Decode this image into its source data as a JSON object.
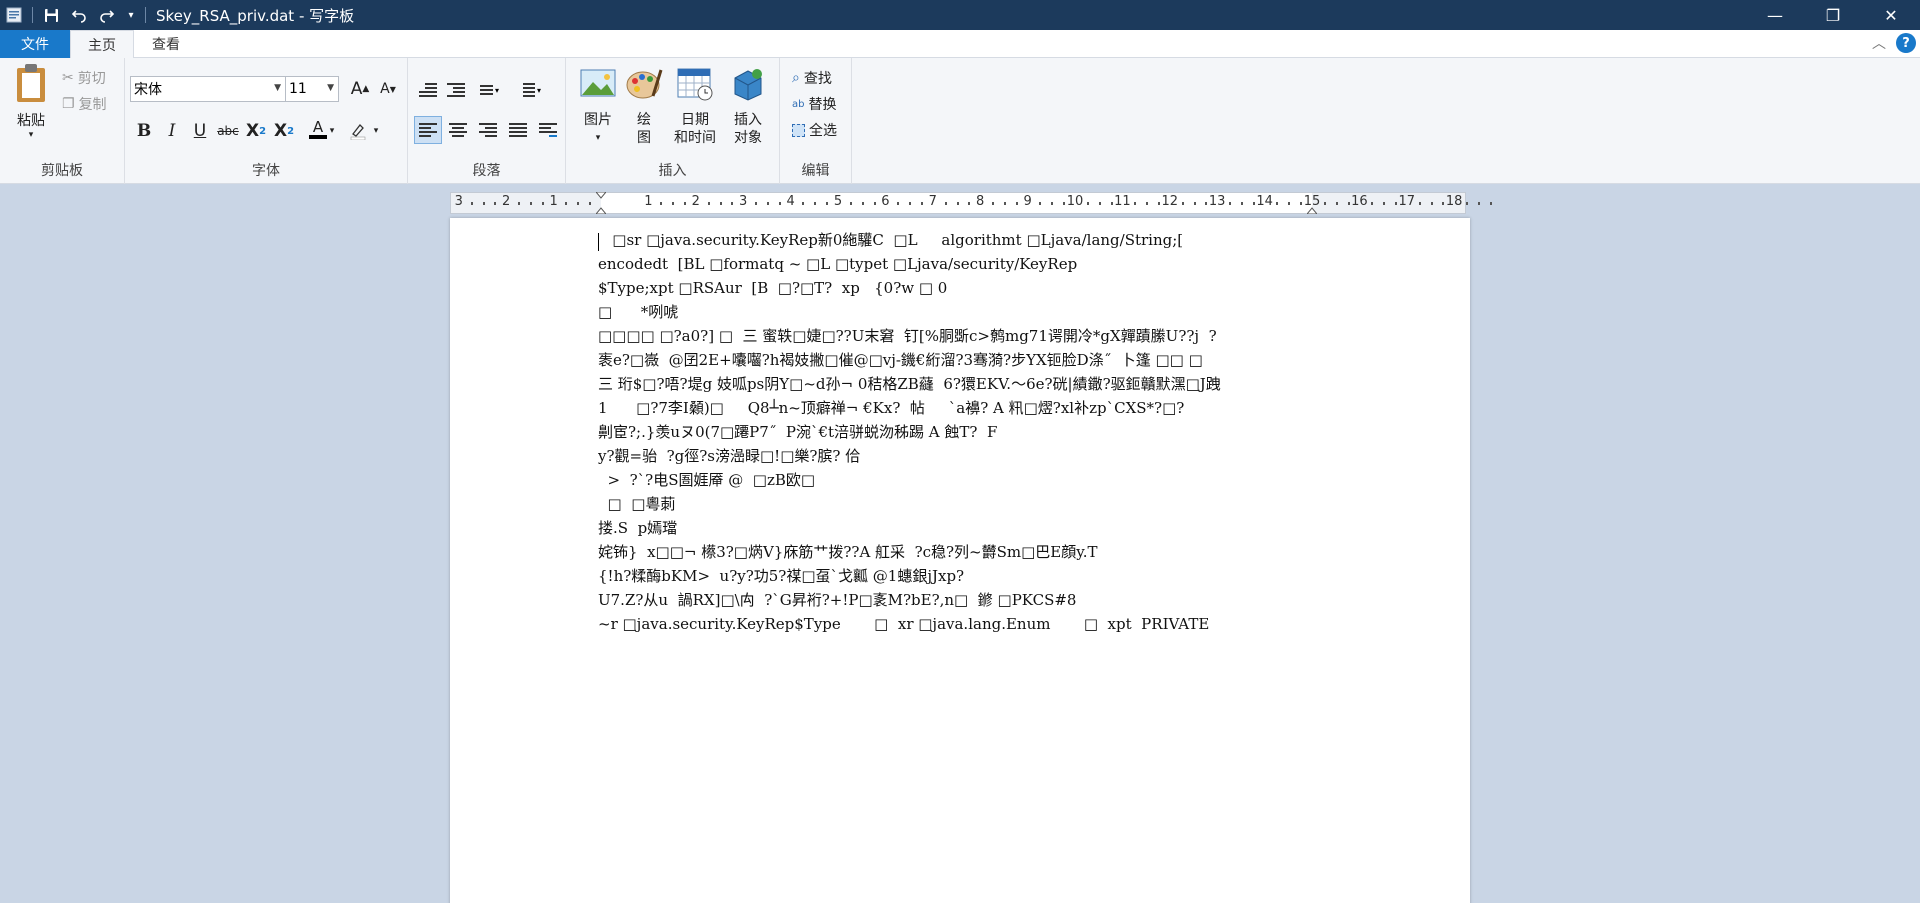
{
  "window": {
    "title": "Skey_RSA_priv.dat - 写字板",
    "controls": {
      "minimize": "—",
      "restore": "❐",
      "close": "✕"
    }
  },
  "tabs": {
    "file": "文件",
    "home": "主页",
    "view": "查看"
  },
  "ribbon": {
    "clipboard": {
      "paste": "粘贴",
      "cut": "剪切",
      "copy": "复制",
      "label": "剪贴板"
    },
    "font": {
      "family": "宋体",
      "size": "11",
      "grow": "A",
      "shrink": "A",
      "bold": "B",
      "italic": "I",
      "underline": "U",
      "strike": "abc",
      "subscript": "X",
      "subscript_mark": "2",
      "superscript": "X",
      "superscript_mark": "2",
      "font_color_glyph": "A",
      "label": "字体"
    },
    "paragraph": {
      "label": "段落"
    },
    "insert": {
      "picture": "图片",
      "paint_1": "绘",
      "paint_2": "图",
      "datetime_1": "日期",
      "datetime_2": "和时间",
      "object_1": "插入",
      "object_2": "对象",
      "label": "插入"
    },
    "edit": {
      "find": "查找",
      "replace": "替换",
      "select_all": "全选",
      "label": "编辑"
    }
  },
  "ruler": {
    "labels": [
      "3",
      "2",
      "1",
      "1",
      "2",
      "3",
      "4",
      "5",
      "6",
      "7",
      "8",
      "9",
      "10",
      "11",
      "12",
      "13",
      "14",
      "15",
      "16",
      "17",
      "18"
    ]
  },
  "document": {
    "lines": [
      "   □sr □java.security.KeyRep新0絁驩C  □L     algorithmt □Ljava/lang/String;[",
      "encodedt  [BL □formatq ~ □L □typet □Ljava/security/KeyRep",
      "$Type;xpt □RSAur  [B  □?□T?  xp   {0?w □ 0",
      "□      *咧唬",
      "□□□□ □?a0?] □  三 蜜轶□婕□??U末窘  钉[%胴斲c>鹩mg71谔開冷*gX嚲蹟縢U??j  ?",
      "袠e?□嶶  @囝2E+囔囓?h褐妓撇□催@□vj-鐖€絎溜?3骞漪?步YX钷脸D涤˝  卜篷 □□ □",
      "三 珩$□?唔?堤g 妓呱ps阴Y□~d孙¬ 0秸格ZB蘕  6?獧EKV.〜6e?硄|績鏾?驱鉕贛默潶□J跩",
      "1      □?7李I顙)□     Q8┴n~顶癖禅¬ €Kx?  帖     `a襣? A 籸□熤?xl补zp`CXS*?□?",
      "劓宦?;.}羡uヌ0(7□蹮P7˝  P涴`€t涪骈蜕沕秭踢 A 蝕T?  F",
      "y?觀=骀  ?g徑?s滂澏睩□!□樂?膑? 佮",
      "  >  ?`?电S圄娾厣 @  □zB欧□",
      "  □  □粵莿",
      "搂.S  p嫣璫",
      "姹钸}  x□□¬ 櫒3?□焫V}庥筋艹拨??A 舡采  ?c稳?列~欝Sm□巴E顔y.T",
      "{!h?糅酶bKM>  u?y?功5?禖□虿`戈瓤 @1蟪銀jJxp?",
      "U7.Z?从u  諣RX]□\\禸  ?`G昇裄?+!P□袲M?bE?,n□  鎀 □PKCS#8",
      "~r □java.security.KeyRep$Type       □  xr □java.lang.Enum       □  xpt  PRIVATE"
    ]
  },
  "colors": {
    "titlebar": "#1c3a5c",
    "file_tab": "#1979ca",
    "canvas": "#c9d5e5"
  }
}
